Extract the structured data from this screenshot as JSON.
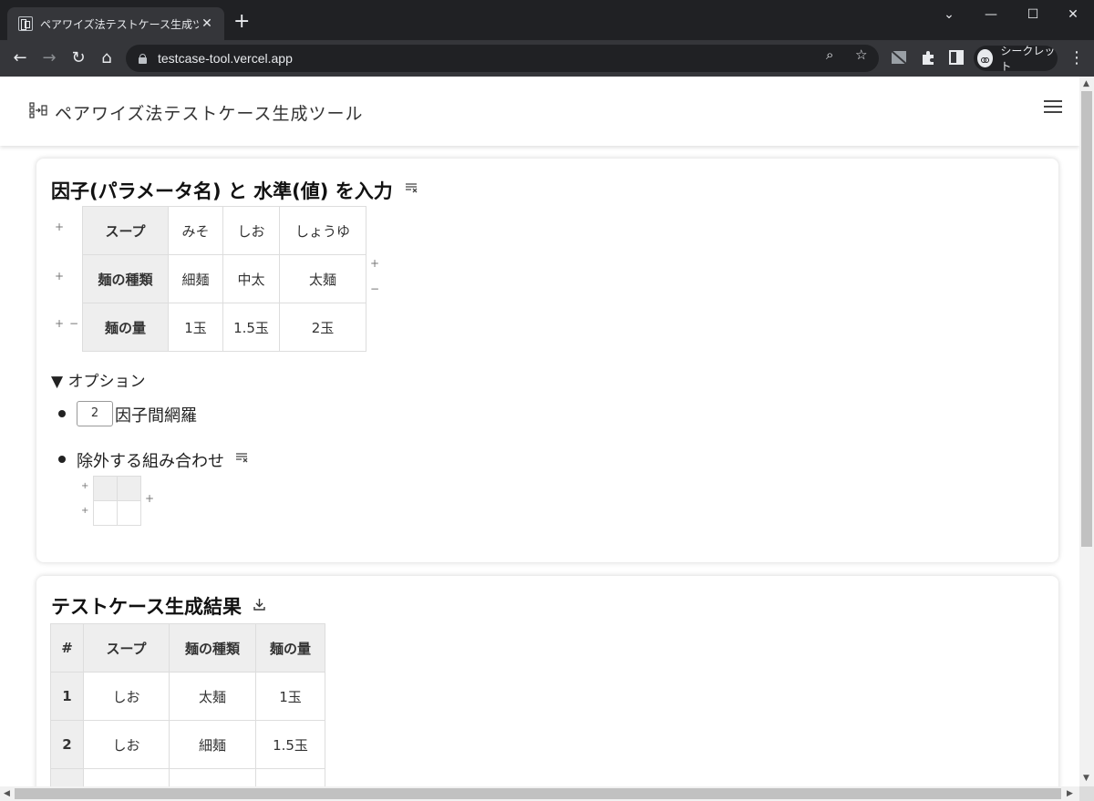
{
  "browser": {
    "tab_title": "ペアワイズ法テストケース生成ツール",
    "tab_close": "✕",
    "new_tab": "+",
    "url": "testcase-tool.vercel.app",
    "profile_label": "シークレット"
  },
  "app": {
    "title": "ペアワイズ法テストケース生成ツール"
  },
  "input_section": {
    "title": "因子(パラメータ名) と 水準(値) を入力",
    "factors": [
      {
        "name": "スープ",
        "levels": [
          "みそ",
          "しお",
          "しょうゆ"
        ]
      },
      {
        "name": "麺の種類",
        "levels": [
          "細麺",
          "中太",
          "太麺"
        ]
      },
      {
        "name": "麺の量",
        "levels": [
          "1玉",
          "1.5玉",
          "2玉"
        ]
      }
    ],
    "add": "+",
    "remove": "−"
  },
  "options": {
    "toggle_label": "▼ オプション",
    "strength_value": "2",
    "strength_label": "因子間網羅",
    "exclusion_label": "除外する組み合わせ"
  },
  "results_section": {
    "title": "テストケース生成結果",
    "headers": [
      "#",
      "スープ",
      "麺の種類",
      "麺の量"
    ],
    "rows": [
      [
        "1",
        "しお",
        "太麺",
        "1玉"
      ],
      [
        "2",
        "しお",
        "細麺",
        "1.5玉"
      ]
    ]
  },
  "colors": {
    "header_bg": "#eeeeee",
    "chrome_dark": "#202124",
    "chrome_toolbar": "#35363a"
  }
}
